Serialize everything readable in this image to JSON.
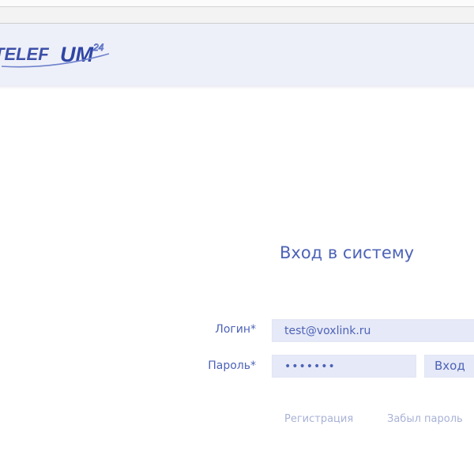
{
  "brand": {
    "logo_text": "TelefUM",
    "logo_superscript": "24"
  },
  "login": {
    "title": "Вход в систему",
    "login_label": "Логин*",
    "login_value": "test@voxlink.ru",
    "password_label": "Пароль*",
    "password_value": "*******",
    "submit_label": "Вход"
  },
  "links": {
    "register": "Регистрация",
    "forgot_password": "Забыл пароль"
  },
  "colors": {
    "accent": "#4d63b7",
    "field_bg": "#e6e9f7",
    "header_bg": "#eef0f9",
    "link": "#a8b2d6"
  }
}
